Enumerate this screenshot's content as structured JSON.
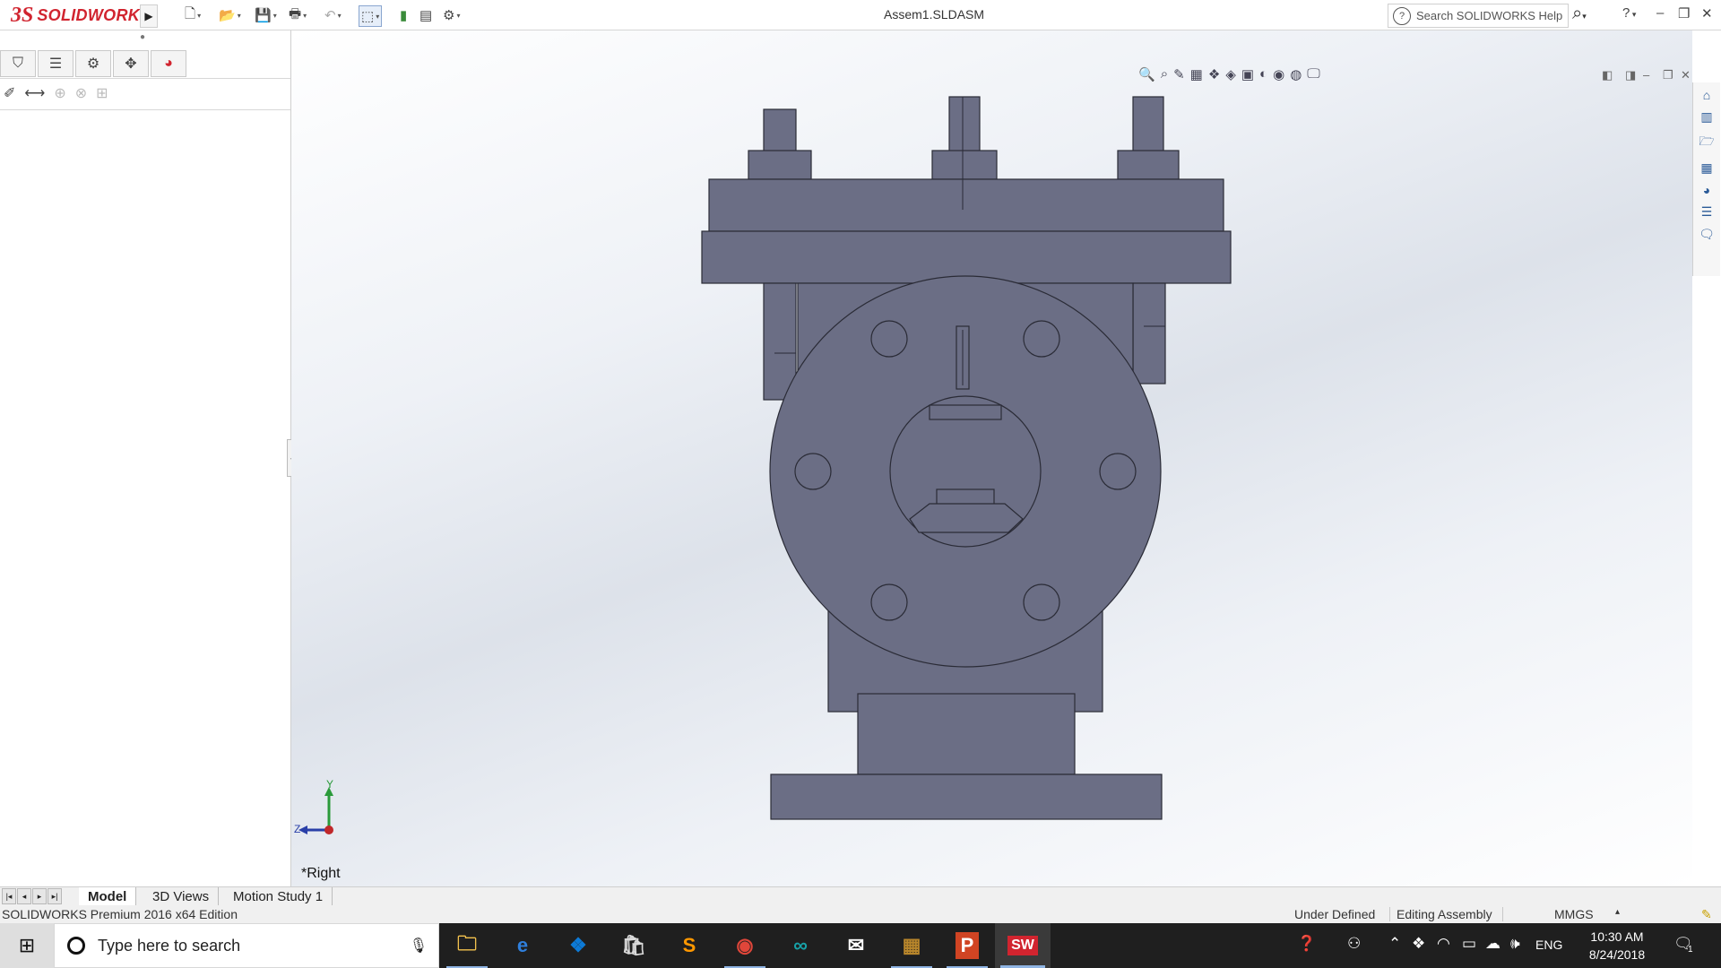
{
  "app": {
    "brand_mark": "3S",
    "brand_name": "SOLIDWORKS"
  },
  "titlebar": {
    "document_title": "Assem1.SLDASM",
    "search_placeholder": "Search SOLIDWORKS Help",
    "help_symbol": "?",
    "win_minimize": "–",
    "win_restore": "❐",
    "win_close": "✕"
  },
  "quick_access": {
    "icons": [
      "new-document-icon",
      "open-icon",
      "save-icon",
      "print-icon",
      "undo-icon",
      "select-icon",
      "rebuild-icon",
      "file-properties-icon",
      "options-icon"
    ],
    "glyphs": [
      "🗋",
      "📂",
      "💾",
      "🖶",
      "↶",
      "⬚",
      "▮",
      "▤",
      "⚙"
    ]
  },
  "feature_manager": {
    "tab_glyphs": [
      "⛉",
      "☰",
      "⚙",
      "✥",
      "◕"
    ],
    "tool_glyphs": [
      "✐",
      "⟷",
      "⊕",
      "⊗",
      "⊞"
    ]
  },
  "heads_up_toolbar": {
    "glyphs": [
      "🔍",
      "⌕",
      "✎",
      "▦",
      "❖",
      "◈",
      "▣",
      "◐",
      "◉",
      "◍",
      "🖵"
    ]
  },
  "task_pane": {
    "glyphs": [
      "⌂",
      "▥",
      "🗁",
      "▦",
      "◕",
      "☰",
      "🗨"
    ]
  },
  "graphics": {
    "view_orientation": "*Right",
    "triad_y": "Y",
    "triad_z": "Z"
  },
  "bottom_tabs": [
    "Model",
    "3D Views",
    "Motion Study 1"
  ],
  "status_bar": {
    "edition": "SOLIDWORKS Premium 2016 x64 Edition",
    "state": "Under Defined",
    "mode": "Editing Assembly",
    "units": "MMGS"
  },
  "taskbar": {
    "search_placeholder": "Type here to search",
    "apps": [
      {
        "name": "file-explorer",
        "glyph": "🗀",
        "color": "#f2c14e"
      },
      {
        "name": "edge",
        "glyph": "e",
        "color": "#2f7fdc"
      },
      {
        "name": "dropbox",
        "glyph": "❖",
        "color": "#0d7ad6"
      },
      {
        "name": "store",
        "glyph": "🛍",
        "color": "#dadada"
      },
      {
        "name": "sublime",
        "glyph": "S",
        "color": "#ff9800"
      },
      {
        "name": "chrome",
        "glyph": "◉",
        "color": "#e0463a"
      },
      {
        "name": "arduino",
        "glyph": "∞",
        "color": "#17a2a8"
      },
      {
        "name": "mail",
        "glyph": "✉",
        "color": "#ffffff"
      },
      {
        "name": "winrar",
        "glyph": "▦",
        "color": "#b8862b"
      },
      {
        "name": "powerpoint",
        "glyph": "P",
        "color": "#d04423"
      },
      {
        "name": "solidworks",
        "glyph": "SW",
        "color": "#d1242f"
      }
    ],
    "language": "ENG",
    "time": "10:30 AM",
    "date": "8/24/2018",
    "notifications": "1"
  },
  "colors": {
    "brand": "#d1242f",
    "part_fill": "#6b6e85",
    "part_stroke": "#2a2b36"
  }
}
